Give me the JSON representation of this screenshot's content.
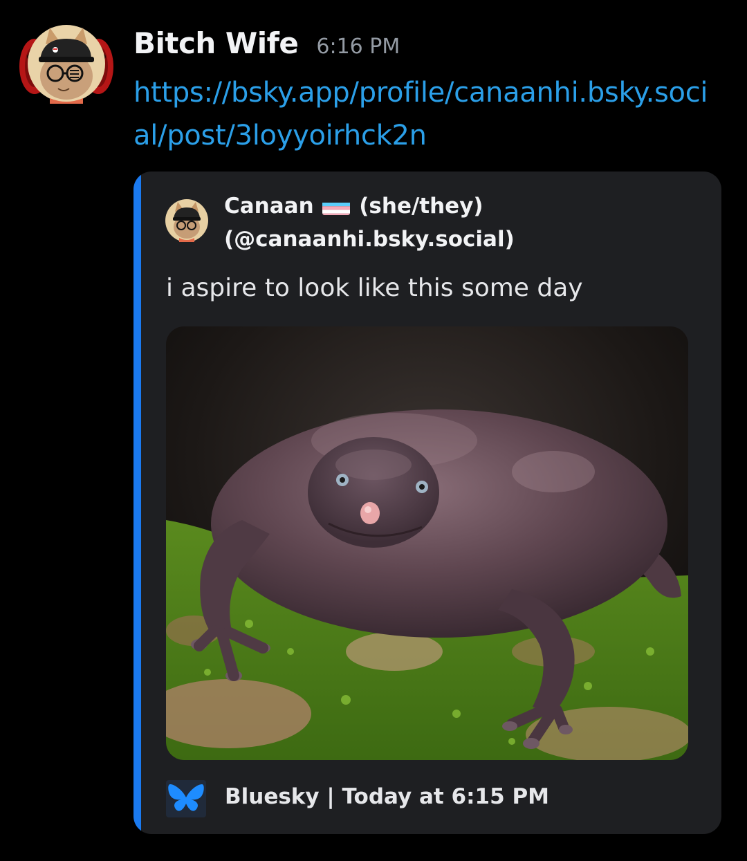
{
  "message": {
    "author": "Bitch Wife",
    "timestamp": "6:16 PM",
    "link": "https://bsky.app/profile/canaanhi.bsky.social/post/3loyyoirhck2n"
  },
  "embed": {
    "author_name": "Canaan",
    "author_flag": "transgender-flag",
    "author_rest": "(she/they) (@canaanhi.bsky.social)",
    "description": "i aspire to look like this some day",
    "image": "purple-frog-photo",
    "footer": {
      "icon": "bluesky-butterfly-icon",
      "text": "Bluesky | Today at 6:15 PM"
    },
    "accent_color": "#1a7af0"
  },
  "colors": {
    "background": "#000000",
    "link": "#2b9fe8",
    "embed_bg": "#1e1f22",
    "timestamp": "#949ba4"
  }
}
